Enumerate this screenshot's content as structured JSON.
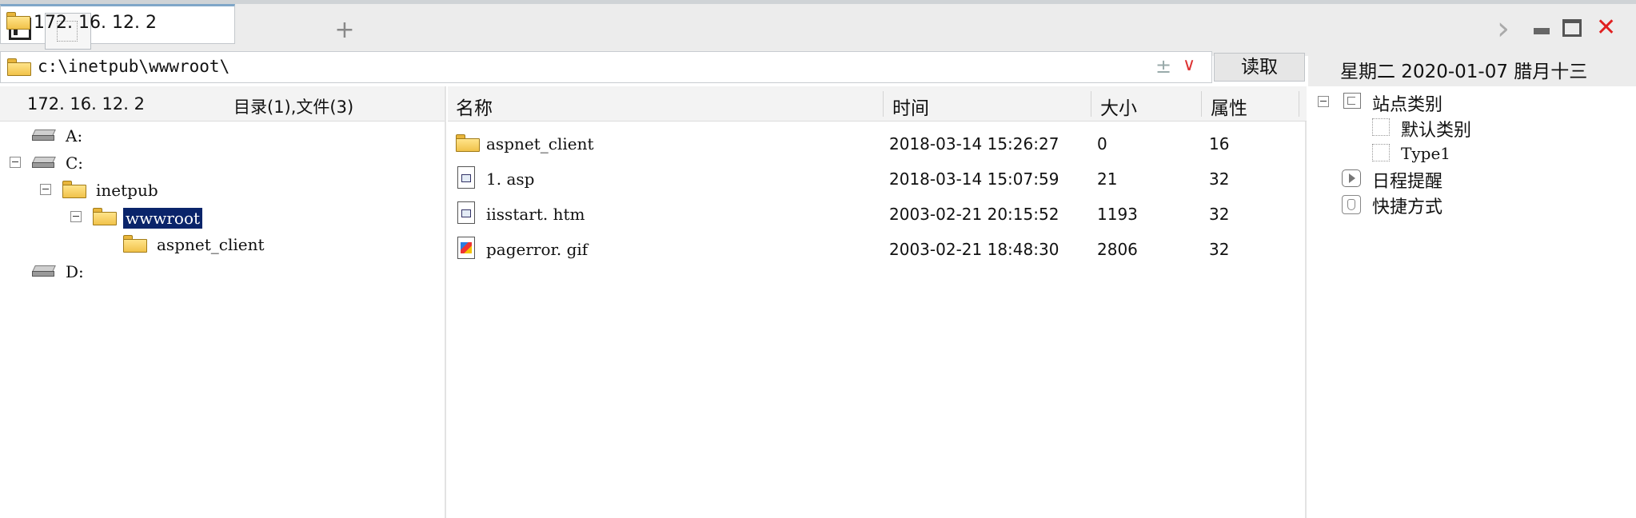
{
  "tab": {
    "title": "172. 16. 12. 2",
    "add_label": "+"
  },
  "window_controls": {
    "next": "›",
    "minimize": "▬",
    "maximize": "□",
    "close": "✕"
  },
  "address": {
    "path": "c:\\inetpub\\wwwroot\\",
    "pm": "±",
    "chevron": "∨"
  },
  "read_button": "读取",
  "date": "星期二 2020-01-07 腊月十三",
  "left_header": {
    "ip": "172. 16. 12. 2",
    "counts": "目录(1),文件(3)"
  },
  "tree": {
    "drive_a": "A:",
    "drive_c": "C:",
    "inetpub": "inetpub",
    "wwwroot": "wwwroot",
    "aspnet_client": "aspnet_client",
    "drive_d": "D:"
  },
  "columns": {
    "name": "名称",
    "time": "时间",
    "size": "大小",
    "attr": "属性"
  },
  "files": [
    {
      "name": "aspnet_client",
      "time": "2018-03-14 15:26:27",
      "size": "0",
      "attr": "16",
      "icon": "folder-icon"
    },
    {
      "name": "1. asp",
      "time": "2018-03-14 15:07:59",
      "size": "21",
      "attr": "32",
      "icon": "script-file-icon"
    },
    {
      "name": "iisstart. htm",
      "time": "2003-02-21 20:15:52",
      "size": "1193",
      "attr": "32",
      "icon": "script-file-icon"
    },
    {
      "name": "pagerror. gif",
      "time": "2003-02-21 18:48:30",
      "size": "2806",
      "attr": "32",
      "icon": "image-file-icon"
    }
  ],
  "right_tree": {
    "site_categories": "站点类别",
    "default_category": "默认类别",
    "type1": "Type1",
    "schedule": "日程提醒",
    "shortcuts": "快捷方式"
  },
  "colors": {
    "selection": "#0a246a",
    "close": "#e02020",
    "folder": "#f1c24a"
  }
}
